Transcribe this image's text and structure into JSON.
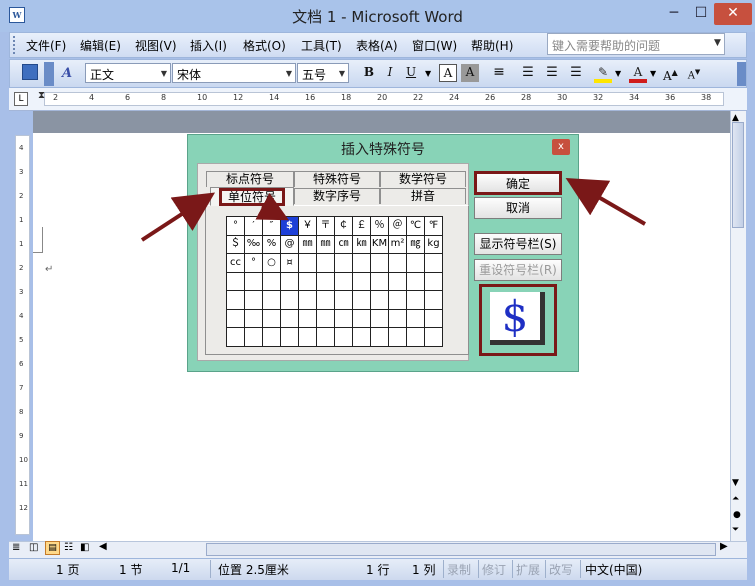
{
  "window": {
    "title": "文档 1 - Microsoft Word",
    "icon_letter": "W",
    "min_glyph": "─",
    "max_glyph": "☐",
    "close_glyph": "✕"
  },
  "menu": {
    "items": [
      "文件(F)",
      "编辑(E)",
      "视图(V)",
      "插入(I)",
      "格式(O)",
      "工具(T)",
      "表格(A)",
      "窗口(W)",
      "帮助(H)"
    ],
    "help_placeholder": "键入需要帮助的问题"
  },
  "toolbar": {
    "style": "正文",
    "font": "宋体",
    "size": "五号",
    "bold": "B",
    "italic": "I",
    "underline": "U",
    "char_border": "A",
    "char_shade": "A",
    "grow_font": "A",
    "shrink_font": "A",
    "style_icon": "A"
  },
  "ruler": {
    "ticks": [
      "2",
      "4",
      "6",
      "8",
      "10",
      "12",
      "14",
      "16",
      "18",
      "20",
      "22",
      "24",
      "26",
      "28",
      "30",
      "32",
      "34",
      "36",
      "38"
    ],
    "vticks": [
      "4",
      "3",
      "2",
      "1",
      "1",
      "2",
      "3",
      "4",
      "5",
      "6",
      "7",
      "8",
      "9",
      "10",
      "11",
      "12"
    ]
  },
  "document": {
    "paragraph_mark": "↵"
  },
  "dialog": {
    "title": "插入特殊符号",
    "close": "x",
    "tabs_row1": [
      "标点符号",
      "特殊符号",
      "数学符号"
    ],
    "tabs_row2": [
      "单位符号",
      "数字序号",
      "拼音"
    ],
    "active_tab": "单位符号",
    "symbols": [
      [
        "°",
        "′",
        "″",
        "$",
        "￥",
        "〒",
        "￠",
        "￡",
        "％",
        "＠",
        "℃",
        "℉"
      ],
      [
        "＄",
        "‰",
        "%",
        "@",
        "㎜",
        "㎜",
        "㎝",
        "㎞",
        "KM",
        "m²",
        "㎎",
        "kg"
      ],
      [
        "cc",
        "°",
        "○",
        "¤",
        "",
        "",
        "",
        "",
        "",
        "",
        "",
        ""
      ],
      [
        "",
        "",
        "",
        "",
        "",
        "",
        "",
        "",
        "",
        "",
        "",
        ""
      ],
      [
        "",
        "",
        "",
        "",
        "",
        "",
        "",
        "",
        "",
        "",
        "",
        ""
      ],
      [
        "",
        "",
        "",
        "",
        "",
        "",
        "",
        "",
        "",
        "",
        "",
        ""
      ],
      [
        "",
        "",
        "",
        "",
        "",
        "",
        "",
        "",
        "",
        "",
        "",
        ""
      ]
    ],
    "selected_symbol": "$",
    "buttons": {
      "ok": "确定",
      "cancel": "取消",
      "show_bar": "显示符号栏(S)",
      "reset_bar": "重设符号栏(R)"
    },
    "preview_symbol": "$"
  },
  "status": {
    "page": "1 页",
    "section": "1 节",
    "pages": "1/1",
    "position": "位置 2.5厘米",
    "line": "1 行",
    "column": "1 列",
    "rec": "录制",
    "trk": "修订",
    "ext": "扩展",
    "ovr": "改写",
    "language": "中文(中国)"
  }
}
